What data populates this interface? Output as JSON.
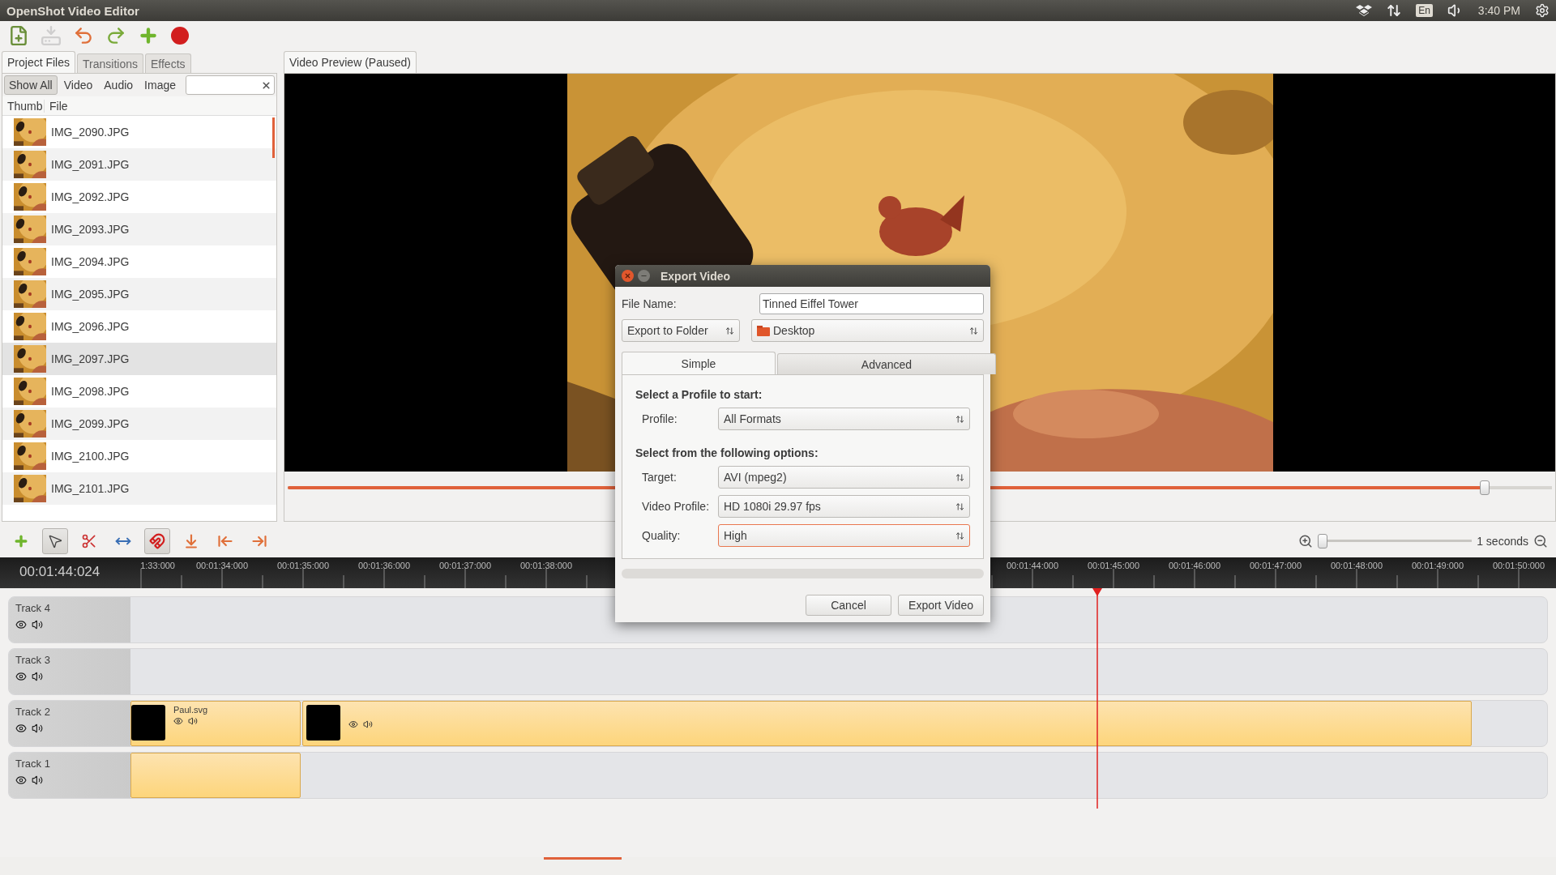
{
  "window": {
    "title": "OpenShot Video Editor"
  },
  "tray": {
    "keyboard": "En",
    "clock": "3:40 PM"
  },
  "toolbar": [
    {
      "kind": "new",
      "disabled": false
    },
    {
      "kind": "save",
      "disabled": true
    },
    {
      "kind": "undo",
      "disabled": false
    },
    {
      "kind": "redo",
      "disabled": false
    },
    {
      "kind": "add",
      "disabled": false
    },
    {
      "kind": "record",
      "disabled": false
    }
  ],
  "left_panel": {
    "tabs": [
      {
        "label": "Project Files",
        "selected": true
      },
      {
        "label": "Transitions",
        "selected": false
      },
      {
        "label": "Effects",
        "selected": false
      }
    ],
    "filters": [
      {
        "label": "Show All",
        "selected": true
      },
      {
        "label": "Video",
        "selected": false
      },
      {
        "label": "Audio",
        "selected": false
      },
      {
        "label": "Image",
        "selected": false
      }
    ],
    "columns": [
      "Thumb",
      "File"
    ],
    "files": [
      {
        "name": "IMG_2090.JPG",
        "selected": false
      },
      {
        "name": "IMG_2091.JPG",
        "selected": false
      },
      {
        "name": "IMG_2092.JPG",
        "selected": false
      },
      {
        "name": "IMG_2093.JPG",
        "selected": false
      },
      {
        "name": "IMG_2094.JPG",
        "selected": false
      },
      {
        "name": "IMG_2095.JPG",
        "selected": false
      },
      {
        "name": "IMG_2096.JPG",
        "selected": false
      },
      {
        "name": "IMG_2097.JPG",
        "selected": true
      },
      {
        "name": "IMG_2098.JPG",
        "selected": false
      },
      {
        "name": "IMG_2099.JPG",
        "selected": false
      },
      {
        "name": "IMG_2100.JPG",
        "selected": false
      },
      {
        "name": "IMG_2101.JPG",
        "selected": false
      }
    ]
  },
  "preview": {
    "tab": "Video Preview (Paused)",
    "position": {
      "level": 0.95
    }
  },
  "timeline": {
    "tools": [
      {
        "kind": "add",
        "pressed": false
      },
      {
        "kind": "select",
        "pressed": true
      },
      {
        "kind": "cut",
        "pressed": false
      },
      {
        "kind": "resize",
        "pressed": false
      },
      {
        "kind": "snap",
        "pressed": true
      },
      {
        "kind": "marker",
        "pressed": false
      },
      {
        "kind": "previous",
        "pressed": false
      },
      {
        "kind": "next",
        "pressed": false
      }
    ],
    "zoom": {
      "level": 0.0,
      "label": "1 seconds"
    },
    "current_time": "00:01:44:024",
    "ruler_left": [
      "1:33:000",
      "00:01:34:000",
      "00:01:35:000",
      "00:01:36:000",
      "00:01:37:000",
      "00:01:38:000"
    ],
    "ruler_right": [
      "00:01:44:000",
      "00:01:45:000",
      "00:01:46:000",
      "00:01:47:000",
      "00:01:48:000",
      "00:01:49:000",
      "00:01:50:000"
    ],
    "tracks": [
      {
        "name": "Track 4"
      },
      {
        "name": "Track 3"
      },
      {
        "name": "Track 2",
        "clips": [
          {
            "kind": "titled",
            "label": "Paul.svg"
          },
          {
            "kind": "video"
          }
        ]
      },
      {
        "name": "Track 1",
        "clips": [
          {
            "kind": "blank"
          }
        ]
      }
    ]
  },
  "dialog": {
    "title": "Export Video",
    "file_name_label": "File Name:",
    "file_name": "Tinned Eiffel Tower",
    "export_mode": "Export to Folder",
    "folder": "Desktop",
    "tabs": [
      {
        "label": "Simple",
        "selected": true
      },
      {
        "label": "Advanced",
        "selected": false
      }
    ],
    "profile_heading": "Select a Profile to start:",
    "profile": {
      "label": "Profile:",
      "value": "All Formats",
      "focused": false
    },
    "options_heading": "Select from the following options:",
    "options": [
      {
        "label": "Target:",
        "value": "AVI (mpeg2)",
        "focused": false
      },
      {
        "label": "Video Profile:",
        "value": "HD 1080i 29.97 fps",
        "focused": false
      },
      {
        "label": "Quality:",
        "value": "High",
        "focused": true
      }
    ],
    "progress": {
      "level": 0
    },
    "buttons": [
      "Cancel",
      "Export Video"
    ]
  }
}
